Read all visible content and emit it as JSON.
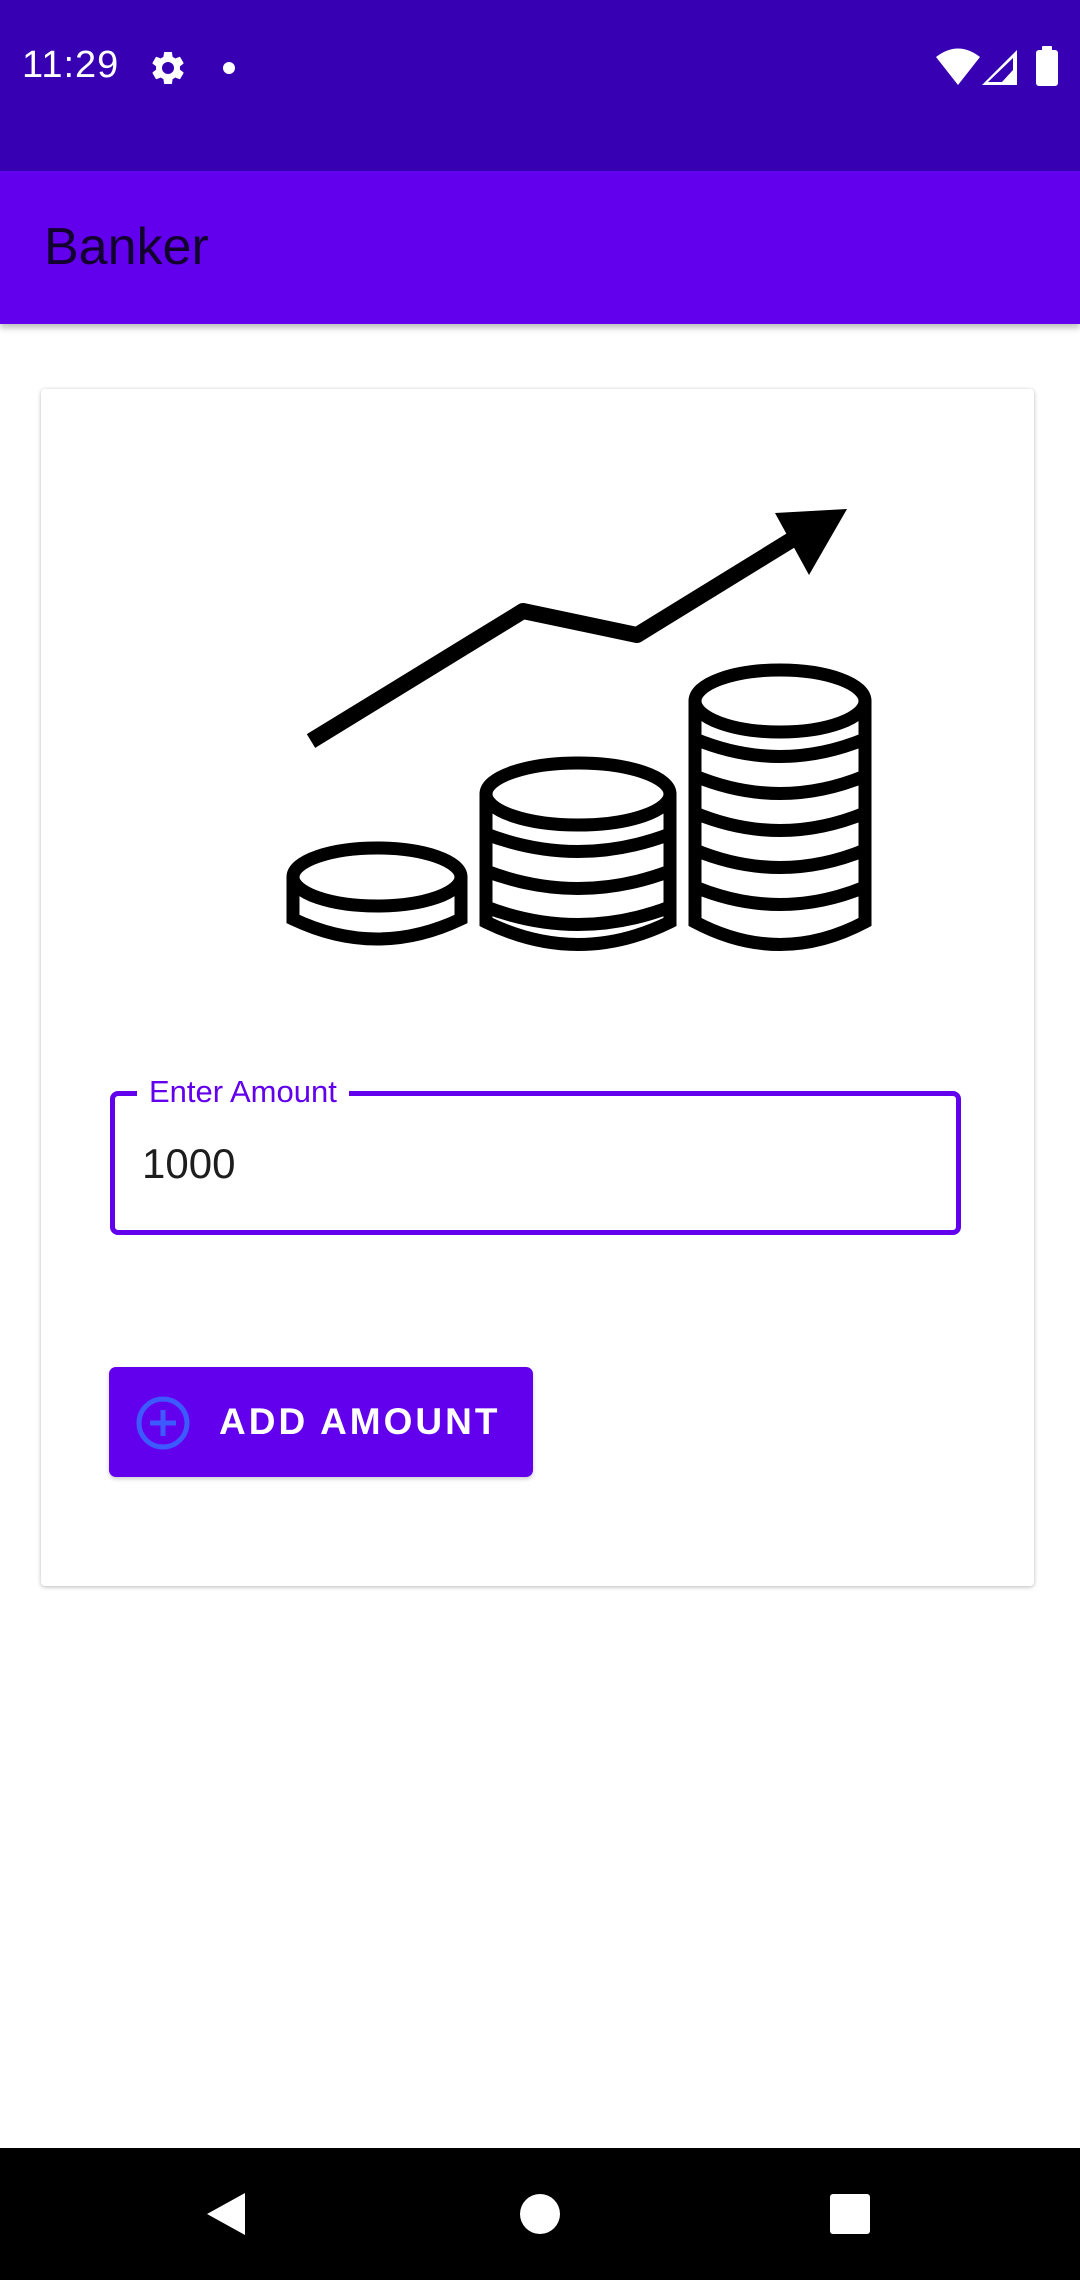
{
  "status_bar": {
    "time": "11:29",
    "icons": [
      "gear-icon",
      "dot-icon",
      "wifi-icon",
      "signal-icon",
      "battery-icon"
    ]
  },
  "app_bar": {
    "title": "Banker"
  },
  "card": {
    "hero_icon": "coins-growth-icon",
    "amount_field": {
      "label": "Enter Amount",
      "value": "1000"
    },
    "add_button": {
      "icon": "add-circle-icon",
      "label": "ADD AMOUNT"
    }
  },
  "nav_bar": {
    "icons": [
      "back-icon",
      "home-icon",
      "recents-icon"
    ]
  },
  "colors": {
    "status_bar": "#3700B3",
    "primary": "#6200EE",
    "button_icon": "#3D5AFE",
    "background": "#FFFFFF"
  }
}
